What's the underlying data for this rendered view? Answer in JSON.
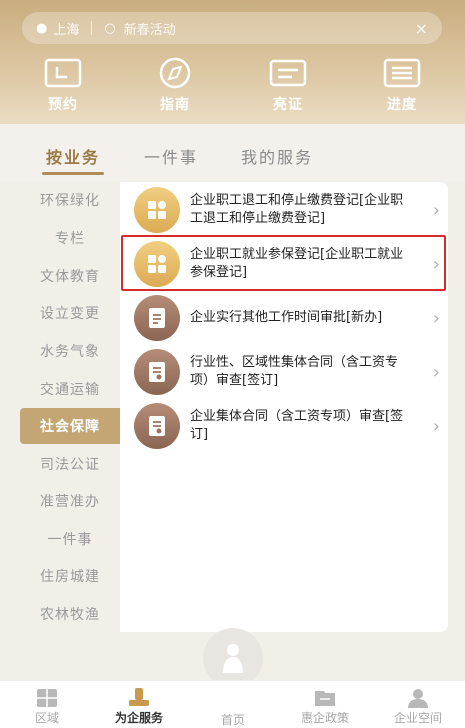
{
  "search": {
    "location": "上海",
    "placeholder": "新春活动",
    "close": "×"
  },
  "quick_actions": [
    {
      "label": "预约",
      "icon": "calendar-icon"
    },
    {
      "label": "指南",
      "icon": "compass-icon"
    },
    {
      "label": "亮证",
      "icon": "id-card-icon"
    },
    {
      "label": "进度",
      "icon": "list-icon"
    }
  ],
  "tabs": [
    "按业务",
    "一件事",
    "我的服务"
  ],
  "active_tab": "按业务",
  "sidebar": [
    "环保绿化",
    "专栏",
    "文体教育",
    "设立变更",
    "水务气象",
    "交通运输",
    "社会保障",
    "司法公证",
    "准营准办",
    "一件事",
    "住房城建",
    "农林牧渔"
  ],
  "active_sidebar": "社会保障",
  "services": [
    {
      "title": "企业职工退工和停止缴费登记[企业职工退工和停止缴费登记]",
      "icon": "grid-icon",
      "color": "gold"
    },
    {
      "title": "企业职工就业参保登记[企业职工就业参保登记]",
      "icon": "grid-icon",
      "color": "gold",
      "highlighted": true
    },
    {
      "title": "企业实行其他工作时间审批[新办]",
      "icon": "document-icon",
      "color": "brown"
    },
    {
      "title": "行业性、区域性集体合同（含工资专项）审查[签订]",
      "icon": "checklist-icon",
      "color": "brown"
    },
    {
      "title": "企业集体合同（含工资专项）审查[签订]",
      "icon": "checklist-icon",
      "color": "brown"
    }
  ],
  "bottom_nav": [
    {
      "label": "区域",
      "icon": "map-icon"
    },
    {
      "label": "为企服务",
      "icon": "service-icon",
      "active": true
    },
    {
      "label": "首页",
      "icon": "home-icon"
    },
    {
      "label": "惠企政策",
      "icon": "policy-icon"
    },
    {
      "label": "企业空间",
      "icon": "user-icon"
    }
  ],
  "colors": {
    "accent": "#b08d57",
    "header": "#c9ad7f",
    "highlight_border": "#d62b2b",
    "gold_icon": "#e2b45e",
    "brown_icon": "#9a7462"
  }
}
